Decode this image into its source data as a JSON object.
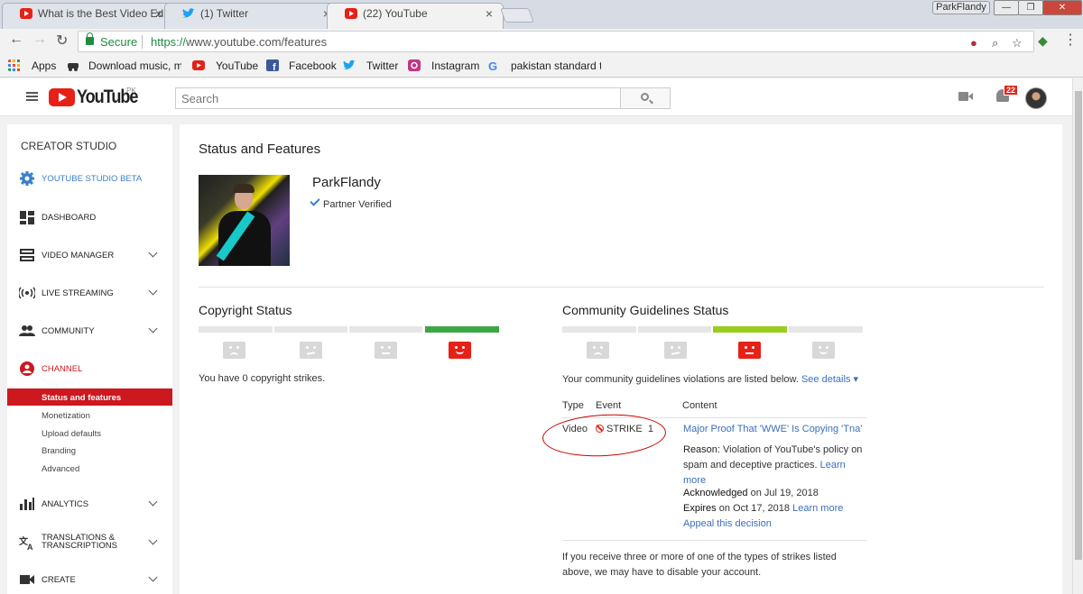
{
  "browser": {
    "tabs": [
      {
        "label": "What is the Best Video Ed",
        "favicon": "youtube-icon"
      },
      {
        "label": "(1) Twitter",
        "favicon": "twitter-icon"
      },
      {
        "label": "(22) YouTube",
        "favicon": "youtube-icon"
      }
    ],
    "profile_name": "ParkFlandy",
    "secure_label": "Secure",
    "url_scheme": "https://",
    "url_host": "www.youtube.com",
    "url_path": "/features",
    "bookmarks": [
      {
        "label": "Apps",
        "icon": "apps-grid-icon"
      },
      {
        "label": "Download music, mo",
        "icon": "car-icon"
      },
      {
        "label": "YouTube",
        "icon": "youtube-icon"
      },
      {
        "label": "Facebook",
        "icon": "facebook-icon"
      },
      {
        "label": "Twitter",
        "icon": "twitter-icon"
      },
      {
        "label": "Instagram",
        "icon": "instagram-icon"
      },
      {
        "label": "pakistan standard tir",
        "icon": "google-icon"
      }
    ]
  },
  "youtube": {
    "logo_text": "YouTube",
    "country": "PK",
    "search_placeholder": "Search",
    "notification_count": "22"
  },
  "sidebar": {
    "title": "CREATOR STUDIO",
    "items": [
      {
        "label": "YOUTUBE STUDIO BETA",
        "icon": "gear-icon"
      },
      {
        "label": "DASHBOARD",
        "icon": "dashboard-icon"
      },
      {
        "label": "VIDEO MANAGER",
        "icon": "video-manager-icon"
      },
      {
        "label": "LIVE STREAMING",
        "icon": "live-icon"
      },
      {
        "label": "COMMUNITY",
        "icon": "community-icon"
      },
      {
        "label": "CHANNEL",
        "icon": "channel-icon"
      },
      {
        "label": "ANALYTICS",
        "icon": "analytics-icon"
      },
      {
        "label": "TRANSLATIONS & TRANSCRIPTIONS",
        "icon": "translate-icon"
      },
      {
        "label": "CREATE",
        "icon": "create-icon"
      }
    ],
    "channel_sub": [
      "Status and features",
      "Monetization",
      "Upload defaults",
      "Branding",
      "Advanced"
    ]
  },
  "main": {
    "title": "Status and Features",
    "channel_name": "ParkFlandy",
    "partner_status": "Partner Verified",
    "copyright": {
      "title": "Copyright Status",
      "message": "You have 0 copyright strikes."
    },
    "community": {
      "title": "Community Guidelines Status",
      "message": "Your community guidelines violations are listed below.",
      "see_details": "See details",
      "col_type": "Type",
      "col_event": "Event",
      "col_content": "Content",
      "row": {
        "type": "Video",
        "event": "STRIKE",
        "count": "1",
        "content_title": "Major Proof That 'WWE' Is Copying 'Tna'",
        "reason_label": "Reason:",
        "reason_text": "Violation of YouTube's policy on spam and deceptive practices.",
        "learn_more": "Learn more",
        "ack_label": "Acknowledged",
        "ack_text": "on Jul 19, 2018",
        "expires_label": "Expires",
        "expires_text": "on Oct 17, 2018",
        "learn_more2": "Learn more",
        "appeal": "Appeal this decision"
      },
      "footer": "If you receive three or more of one of the types of strikes listed above, we may have to disable your account."
    }
  }
}
